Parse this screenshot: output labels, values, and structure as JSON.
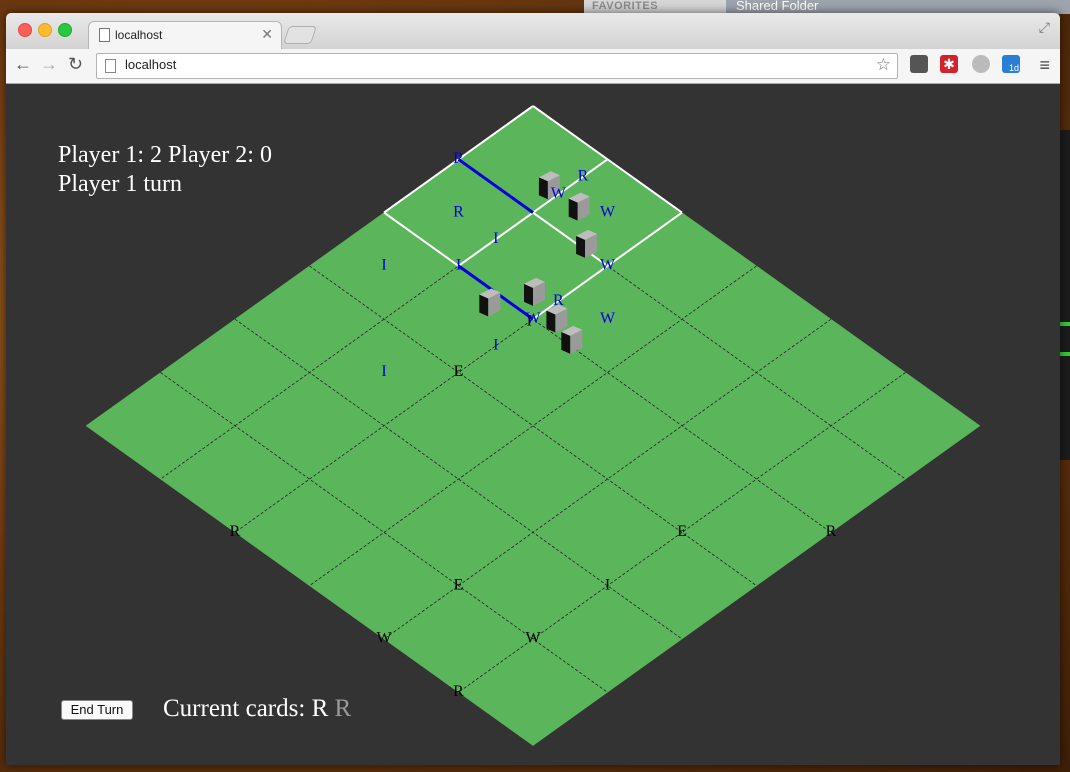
{
  "desktop": {
    "finder_header": "FAVORITES",
    "shared_folder": "Shared Folder"
  },
  "browser": {
    "tab_title": "localhost",
    "url": "localhost"
  },
  "game": {
    "score_line": "Player 1: 2 Player 2: 0",
    "turn_line": "Player 1 turn",
    "end_turn_label": "End Turn",
    "cards_label": "Current cards:",
    "cards": [
      {
        "letter": "R",
        "active": true
      },
      {
        "letter": "R",
        "active": false
      }
    ],
    "board": {
      "size": 6,
      "tile_color": "#5bb55b",
      "grid_color": "#222222",
      "highlight_color": "#ffffff",
      "claimed_color": "#0000dd",
      "label_color_default": "#000000",
      "label_color_claimed": "#0000dd",
      "highlight_square": [
        0,
        2,
        0,
        2
      ],
      "claimed_edges": [
        [
          [
            0,
            1
          ],
          [
            1,
            1
          ]
        ],
        [
          [
            1,
            2
          ],
          [
            2,
            2
          ]
        ]
      ],
      "labels": [
        {
          "text": "R",
          "u": 0,
          "v": 1,
          "claimed": true
        },
        {
          "text": "R",
          "u": 0.5,
          "v": 1.5,
          "claimed": true
        },
        {
          "text": "I",
          "u": 0.5,
          "v": 2.5,
          "claimed": true
        },
        {
          "text": "R",
          "u": 1,
          "v": 0.33,
          "claimed": true
        },
        {
          "text": "W",
          "u": 1,
          "v": 0.66,
          "claimed": true
        },
        {
          "text": "I",
          "u": 1,
          "v": 1.5,
          "claimed": true
        },
        {
          "text": "I",
          "u": 1,
          "v": 2,
          "claimed": true
        },
        {
          "text": "I",
          "u": 1.5,
          "v": 3.5,
          "claimed": true
        },
        {
          "text": "W",
          "u": 1.5,
          "v": 0.5,
          "claimed": true
        },
        {
          "text": "W",
          "u": 2,
          "v": 1,
          "claimed": true
        },
        {
          "text": "R",
          "u": 2,
          "v": 1.66,
          "claimed": true
        },
        {
          "text": "W",
          "u": 2,
          "v": 2,
          "claimed": true
        },
        {
          "text": "I",
          "u": 2,
          "v": 2.5,
          "claimed": true
        },
        {
          "text": "W",
          "u": 2.5,
          "v": 1.5,
          "claimed": true
        },
        {
          "text": "I",
          "u": 2,
          "v": 2.05,
          "claimed": false
        },
        {
          "text": "E",
          "u": 2,
          "v": 3,
          "claimed": false
        },
        {
          "text": "R",
          "u": 2,
          "v": 6,
          "claimed": false
        },
        {
          "text": "R",
          "u": 6,
          "v": 2,
          "claimed": false
        },
        {
          "text": "E",
          "u": 5,
          "v": 3,
          "claimed": false
        },
        {
          "text": "I",
          "u": 5,
          "v": 4,
          "claimed": false
        },
        {
          "text": "E",
          "u": 4,
          "v": 5,
          "claimed": false
        },
        {
          "text": "W",
          "u": 4,
          "v": 6,
          "claimed": false
        },
        {
          "text": "W",
          "u": 5,
          "v": 5,
          "claimed": false
        },
        {
          "text": "R",
          "u": 5,
          "v": 6,
          "claimed": false
        }
      ],
      "pieces": [
        {
          "u": 0.9,
          "v": 0.7
        },
        {
          "u": 1.3,
          "v": 0.7
        },
        {
          "u": 1.7,
          "v": 1.0
        },
        {
          "u": 1.8,
          "v": 1.8
        },
        {
          "u": 1.6,
          "v": 2.2
        },
        {
          "u": 2.2,
          "v": 1.9
        },
        {
          "u": 2.5,
          "v": 2.0
        }
      ]
    }
  }
}
